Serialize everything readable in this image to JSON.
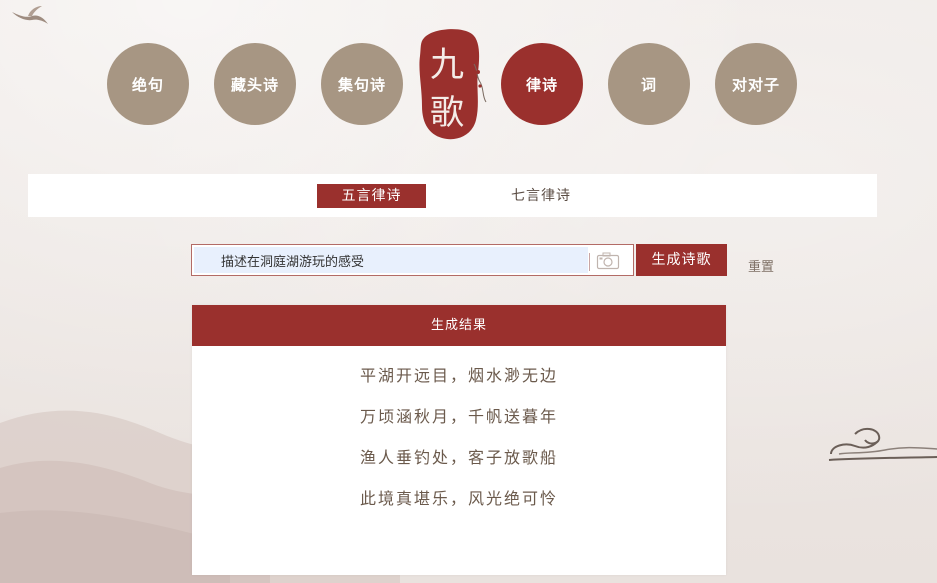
{
  "nav": {
    "items": [
      {
        "label": "绝句",
        "active": false
      },
      {
        "label": "藏头诗",
        "active": false
      },
      {
        "label": "集句诗",
        "active": false
      },
      {
        "label": "律诗",
        "active": true
      },
      {
        "label": "词",
        "active": false
      },
      {
        "label": "对对子",
        "active": false
      }
    ]
  },
  "logo": {
    "glyph_top": "九",
    "glyph_bottom": "歌",
    "side_text": "人工智能"
  },
  "tabs": {
    "items": [
      {
        "label": "五言律诗",
        "active": true
      },
      {
        "label": "七言律诗",
        "active": false
      }
    ]
  },
  "input": {
    "value": "描述在洞庭湖游玩的感受",
    "camera_icon": "camera-icon"
  },
  "buttons": {
    "generate": "生成诗歌",
    "reset": "重置"
  },
  "result": {
    "header": "生成结果",
    "lines": [
      "平湖开远目，烟水渺无边",
      "万顷涵秋月，千帆送暮年",
      "渔人垂钓处，客子放歌船",
      "此境真堪乐，风光绝可怜"
    ]
  },
  "colors": {
    "primary": "#9a302d",
    "nav_inactive": "#a79683",
    "background": "#ece6e3"
  }
}
